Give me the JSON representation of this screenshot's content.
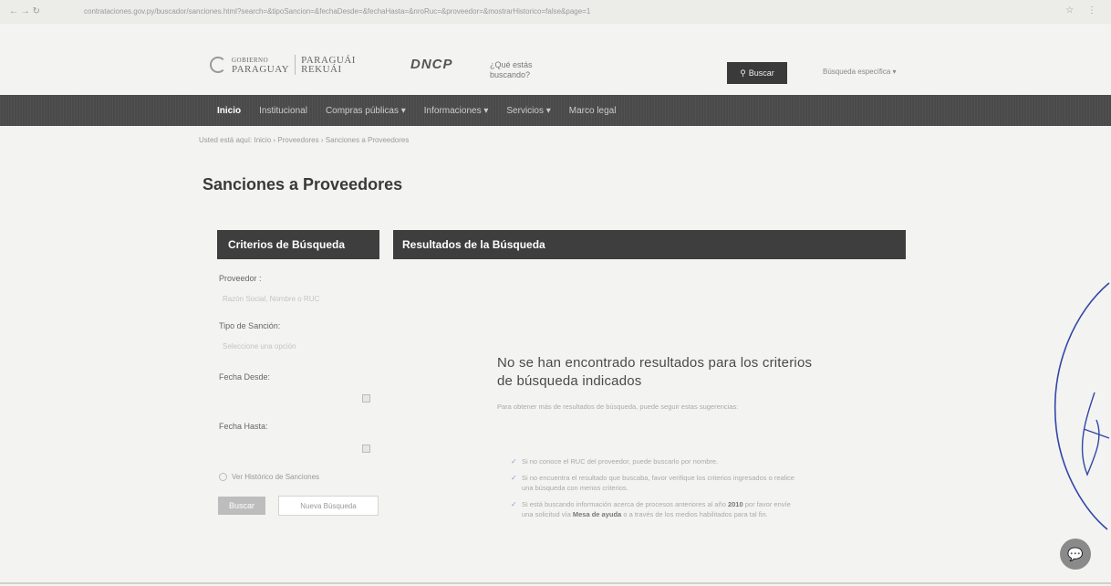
{
  "browser": {
    "url": "contrataciones.gov.py/buscador/sanciones.html?search=&tipoSancion=&fechaDesde=&fechaHasta=&nroRuc=&proveedor=&mostrarHistorico=false&page=1"
  },
  "header": {
    "logo_gobierno": "GOBIERNO",
    "logo_paraguay": "PARAGUAY",
    "logo_paragua": "PARAGUÁI",
    "logo_rekuai": "REKUÁI",
    "dncp": "DNCP",
    "search_hint": "¿Qué estás buscando?",
    "search_button": "Buscar",
    "advanced_search": "Búsqueda específica ▾"
  },
  "nav": {
    "items": [
      {
        "label": "Inicio"
      },
      {
        "label": "Institucional"
      },
      {
        "label": "Compras públicas ▾"
      },
      {
        "label": "Informaciones ▾"
      },
      {
        "label": "Servicios ▾"
      },
      {
        "label": "Marco legal"
      }
    ]
  },
  "breadcrumb": "Usted está aquí:  Inicio  ›  Proveedores  ›  Sanciones a Proveedores",
  "page_title": "Sanciones a Proveedores",
  "criteria": {
    "title": "Criterios de Búsqueda",
    "proveedor_label": "Proveedor :",
    "proveedor_placeholder": "Razón Social, Nombre o RUC",
    "tipo_label": "Tipo de Sanción:",
    "tipo_placeholder": "Seleccione una opción",
    "fecha_desde_label": "Fecha Desde:",
    "fecha_hasta_label": "Fecha Hasta:",
    "historico_label": "Ver Histórico de Sanciones",
    "buscar_button": "Buscar",
    "nueva_button": "Nueva Búsqueda"
  },
  "results": {
    "title": "Resultados de la Búsqueda",
    "no_results_title": "No se han encontrado resultados para los criterios de búsqueda indicados",
    "no_results_sub": "Para obtener más de resultados de búsqueda, puede seguir estas sugerencias:",
    "tip1": "Si no conoce el RUC del proveedor, puede buscarlo por nombre.",
    "tip2": "Si no encuentra el resultado que buscaba, favor verifique los criterios ingresados o realice una búsqueda con menos criterios.",
    "tip3_a": "Si está buscando información acerca de procesos anteriores al año ",
    "tip3_year": "2010",
    "tip3_b": " por favor envíe una solicitud vía ",
    "tip3_mesa": "Mesa de ayuda",
    "tip3_c": " o a través de los medios habilitados para tal fin."
  }
}
